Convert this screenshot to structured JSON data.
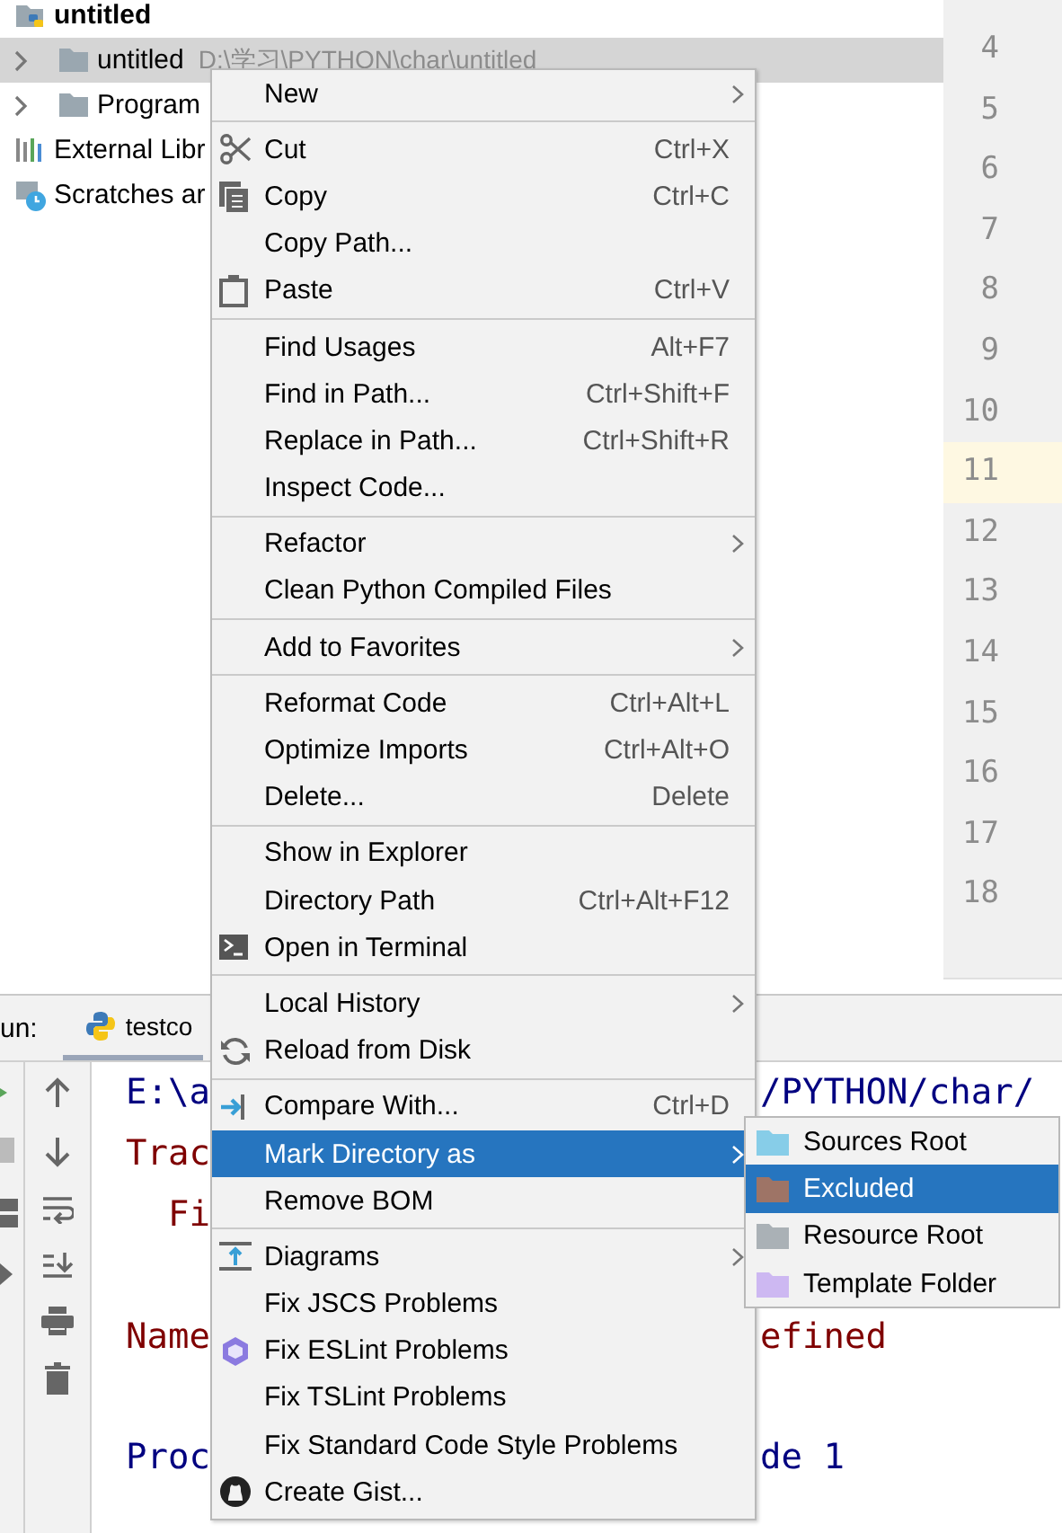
{
  "project": {
    "name": "untitled",
    "children": [
      {
        "name": "untitled",
        "path": "D:\\学习\\PYTHON\\char\\untitled",
        "kind": "folder",
        "selected": true,
        "expanded": false
      },
      {
        "name": "Program",
        "kind": "folder",
        "selected": false,
        "expanded": false
      },
      {
        "name": "External Libr",
        "kind": "libraries",
        "selected": false
      },
      {
        "name": "Scratches ar",
        "kind": "scratches",
        "selected": false
      }
    ]
  },
  "gutter": {
    "lines": [
      {
        "number": "4",
        "current": false
      },
      {
        "number": "5",
        "current": false
      },
      {
        "number": "6",
        "current": false
      },
      {
        "number": "7",
        "current": false
      },
      {
        "number": "8",
        "current": false
      },
      {
        "number": "9",
        "current": false
      },
      {
        "number": "10",
        "current": false
      },
      {
        "number": "11",
        "current": true
      },
      {
        "number": "12",
        "current": false
      },
      {
        "number": "13",
        "current": false
      },
      {
        "number": "14",
        "current": false
      },
      {
        "number": "15",
        "current": false
      },
      {
        "number": "16",
        "current": false
      },
      {
        "number": "17",
        "current": false
      },
      {
        "number": "18",
        "current": false
      }
    ]
  },
  "run_panel": {
    "label": "un:",
    "tab": {
      "label": "testco",
      "selected": true
    },
    "console": [
      {
        "text": "E:\\a",
        "rest": "/PYTHON/char/",
        "kind": "path"
      },
      {
        "text": "Trac",
        "kind": "error"
      },
      {
        "text": "  Fi",
        "kind": "error"
      },
      {
        "kind": "blank"
      },
      {
        "text": "Name",
        "rest": "efined",
        "kind": "error"
      },
      {
        "kind": "blank"
      },
      {
        "text": "Proc",
        "rest": "de 1",
        "kind": "path"
      }
    ]
  },
  "context_menu": {
    "groups": [
      {
        "items": [
          {
            "label": "New",
            "submenu": true,
            "selected": false
          }
        ]
      },
      {
        "items": [
          {
            "label": "Cut",
            "shortcut": "Ctrl+X",
            "selected": false
          },
          {
            "label": "Copy",
            "shortcut": "Ctrl+C",
            "selected": false
          },
          {
            "label": "Copy Path...",
            "selected": false
          },
          {
            "label": "Paste",
            "shortcut": "Ctrl+V",
            "selected": false
          }
        ]
      },
      {
        "items": [
          {
            "label": "Find Usages",
            "shortcut": "Alt+F7",
            "selected": false
          },
          {
            "label": "Find in Path...",
            "shortcut": "Ctrl+Shift+F",
            "selected": false
          },
          {
            "label": "Replace in Path...",
            "shortcut": "Ctrl+Shift+R",
            "selected": false
          },
          {
            "label": "Inspect Code...",
            "selected": false
          }
        ]
      },
      {
        "items": [
          {
            "label": "Refactor",
            "submenu": true,
            "selected": false
          },
          {
            "label": "Clean Python Compiled Files",
            "selected": false
          }
        ]
      },
      {
        "items": [
          {
            "label": "Add to Favorites",
            "submenu": true,
            "selected": false
          }
        ]
      },
      {
        "items": [
          {
            "label": "Reformat Code",
            "shortcut": "Ctrl+Alt+L",
            "selected": false
          },
          {
            "label": "Optimize Imports",
            "shortcut": "Ctrl+Alt+O",
            "selected": false
          },
          {
            "label": "Delete...",
            "shortcut": "Delete",
            "selected": false
          }
        ]
      },
      {
        "items": [
          {
            "label": "Show in Explorer",
            "selected": false
          },
          {
            "label": "Directory Path",
            "shortcut": "Ctrl+Alt+F12",
            "selected": false
          },
          {
            "label": "Open in Terminal",
            "selected": false
          }
        ]
      },
      {
        "items": [
          {
            "label": "Local History",
            "submenu": true,
            "selected": false
          },
          {
            "label": "Reload from Disk",
            "selected": false
          }
        ]
      },
      {
        "items": [
          {
            "label": "Compare With...",
            "shortcut": "Ctrl+D",
            "selected": false
          },
          {
            "label": "Mark Directory as",
            "submenu": true,
            "selected": true
          },
          {
            "label": "Remove BOM",
            "selected": false
          }
        ]
      },
      {
        "items": [
          {
            "label": "Diagrams",
            "submenu": true,
            "selected": false
          },
          {
            "label": "Fix JSCS Problems",
            "selected": false
          },
          {
            "label": "Fix ESLint Problems",
            "selected": false
          },
          {
            "label": "Fix TSLint Problems",
            "selected": false
          },
          {
            "label": "Fix Standard Code Style Problems",
            "selected": false
          },
          {
            "label": "Create Gist...",
            "selected": false
          }
        ]
      }
    ]
  },
  "submenu": {
    "items": [
      {
        "label": "Sources Root",
        "color": "#87cde8",
        "selected": false
      },
      {
        "label": "Excluded",
        "color": "#9e7466",
        "selected": true
      },
      {
        "label": "Resource Root",
        "color": "#aab1b6",
        "selected": false
      },
      {
        "label": "Template Folder",
        "color": "#cdb8f2",
        "selected": false
      }
    ]
  }
}
